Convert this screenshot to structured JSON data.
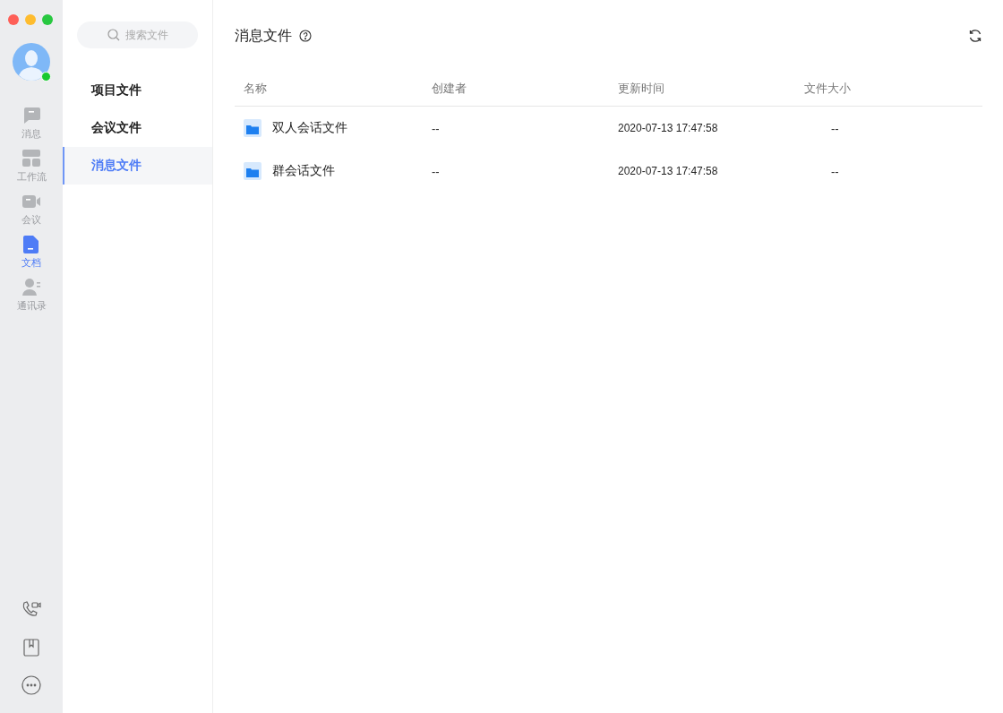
{
  "user": {
    "online": true
  },
  "nav": [
    {
      "label": "消息",
      "selected": false
    },
    {
      "label": "工作流",
      "selected": false
    },
    {
      "label": "会议",
      "selected": false
    },
    {
      "label": "文档",
      "selected": true
    },
    {
      "label": "通讯录",
      "selected": false
    }
  ],
  "search": {
    "placeholder": "搜索文件"
  },
  "folders": [
    {
      "label": "项目文件",
      "selected": false
    },
    {
      "label": "会议文件",
      "selected": false
    },
    {
      "label": "消息文件",
      "selected": true
    }
  ],
  "main": {
    "title": "消息文件"
  },
  "table": {
    "columns": [
      "名称",
      "创建者",
      "更新时间",
      "文件大小"
    ],
    "rows": [
      {
        "name": "双人会话文件",
        "creator": "--",
        "updated": "2020-07-13 17:47:58",
        "size": "--"
      },
      {
        "name": "群会话文件",
        "creator": "--",
        "updated": "2020-07-13 17:47:58",
        "size": "--"
      }
    ]
  }
}
